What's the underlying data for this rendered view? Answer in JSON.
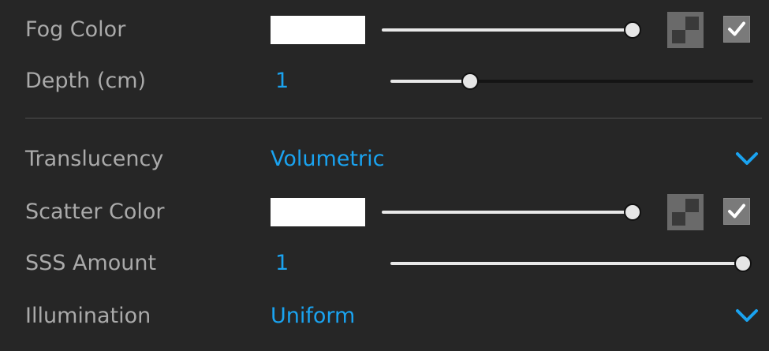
{
  "fog_color": {
    "label": "Fog Color",
    "swatch_color": "#ffffff",
    "slider_value": 1.0,
    "enabled": true,
    "icons": {
      "picker": "checker-swatch-icon",
      "toggle": "checkmark-icon"
    }
  },
  "depth": {
    "label": "Depth (cm)",
    "value": "1",
    "slider_value": 0.22
  },
  "translucency": {
    "label": "Translucency",
    "selected": "Volumetric",
    "icon": "chevron-down-icon"
  },
  "scatter_color": {
    "label": "Scatter Color",
    "swatch_color": "#ffffff",
    "slider_value": 1.0,
    "enabled": true,
    "icons": {
      "picker": "checker-swatch-icon",
      "toggle": "checkmark-icon"
    }
  },
  "sss_amount": {
    "label": "SSS Amount",
    "value": "1",
    "slider_value": 1.0
  },
  "illumination": {
    "label": "Illumination",
    "selected": "Uniform",
    "icon": "chevron-down-icon"
  },
  "colors": {
    "background": "#262626",
    "label_text": "#aaaaaa",
    "accent": "#1aa3f0",
    "slider_fill": "#e8e8e8",
    "slider_track": "#141414"
  }
}
